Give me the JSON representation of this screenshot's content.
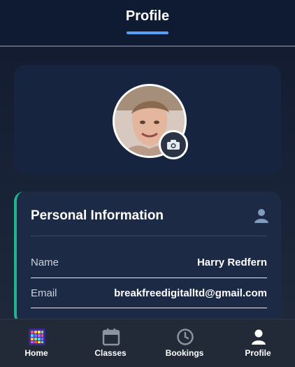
{
  "header": {
    "title": "Profile"
  },
  "profile_card": {
    "avatar_icon": "user-photo",
    "camera_icon": "camera-icon"
  },
  "personal_info": {
    "title": "Personal Information",
    "rows": [
      {
        "label": "Name",
        "value": "Harry Redfern"
      },
      {
        "label": "Email",
        "value": "breakfreedigitalltd@gmail.com"
      }
    ]
  },
  "tabbar": {
    "tabs": [
      {
        "label": "Home",
        "icon": "home-grid-icon"
      },
      {
        "label": "Classes",
        "icon": "calendar-icon"
      },
      {
        "label": "Bookings",
        "icon": "clock-icon"
      },
      {
        "label": "Profile",
        "icon": "person-icon"
      }
    ]
  },
  "colors": {
    "accent": "#5aa0f2",
    "card_border": "#21b58a",
    "tabbar": "#222a38"
  }
}
